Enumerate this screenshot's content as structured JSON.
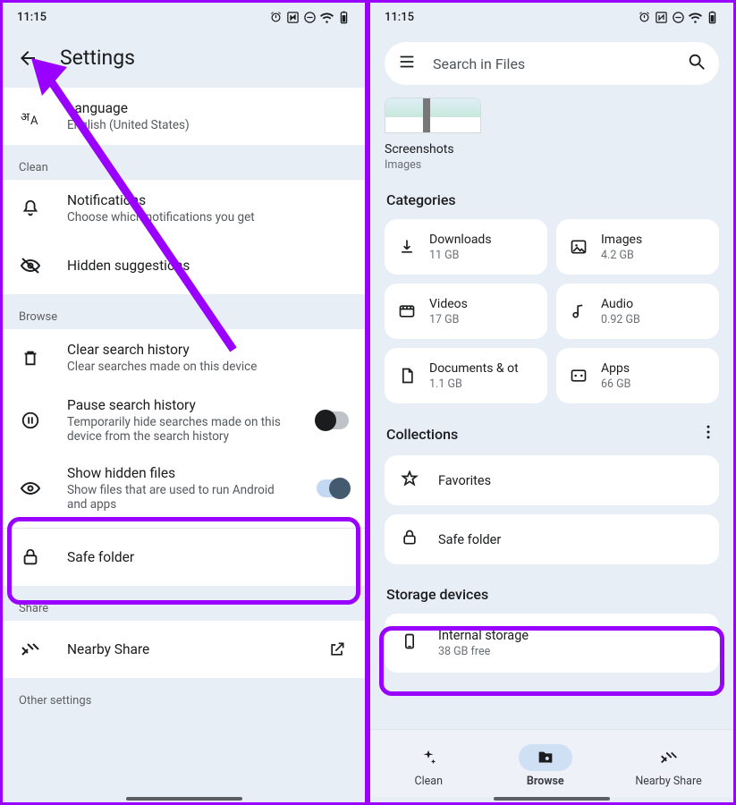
{
  "status": {
    "time": "11:15"
  },
  "left": {
    "title": "Settings",
    "language": {
      "title": "Language",
      "value": "English (United States)"
    },
    "groups": {
      "clean": "Clean",
      "browse": "Browse",
      "share": "Share",
      "other": "Other settings"
    },
    "notifications": {
      "title": "Notifications",
      "sub": "Choose which notifications you get"
    },
    "hidden_suggestions": {
      "title": "Hidden suggestions"
    },
    "clear_search": {
      "title": "Clear search history",
      "sub": "Clear searches made on this device"
    },
    "pause_search": {
      "title": "Pause search history",
      "sub": "Temporarily hide searches made on this device from the search history",
      "on": false
    },
    "show_hidden": {
      "title": "Show hidden files",
      "sub": "Show files that are used to run Android and apps",
      "on": true
    },
    "safe_folder": {
      "title": "Safe folder"
    },
    "nearby_share": {
      "title": "Nearby Share"
    }
  },
  "right": {
    "search_placeholder": "Search in Files",
    "recent": {
      "title": "Screenshots",
      "sub": "Images"
    },
    "sections": {
      "categories": "Categories",
      "collections": "Collections",
      "storage": "Storage devices"
    },
    "categories": {
      "downloads": {
        "title": "Downloads",
        "sub": "11 GB"
      },
      "images": {
        "title": "Images",
        "sub": "4.2 GB"
      },
      "videos": {
        "title": "Videos",
        "sub": "17 GB"
      },
      "audio": {
        "title": "Audio",
        "sub": "0.92 GB"
      },
      "documents": {
        "title": "Documents & other",
        "sub": "1.1 GB"
      },
      "apps": {
        "title": "Apps",
        "sub": "66 GB"
      }
    },
    "collections": {
      "favorites": "Favorites",
      "safe_folder": "Safe folder"
    },
    "storage": {
      "internal": {
        "title": "Internal storage",
        "sub": "38 GB free"
      }
    },
    "nav": {
      "clean": "Clean",
      "browse": "Browse",
      "nearby": "Nearby Share",
      "active": "browse"
    }
  },
  "highlight": {
    "color": "#9a00ff"
  }
}
